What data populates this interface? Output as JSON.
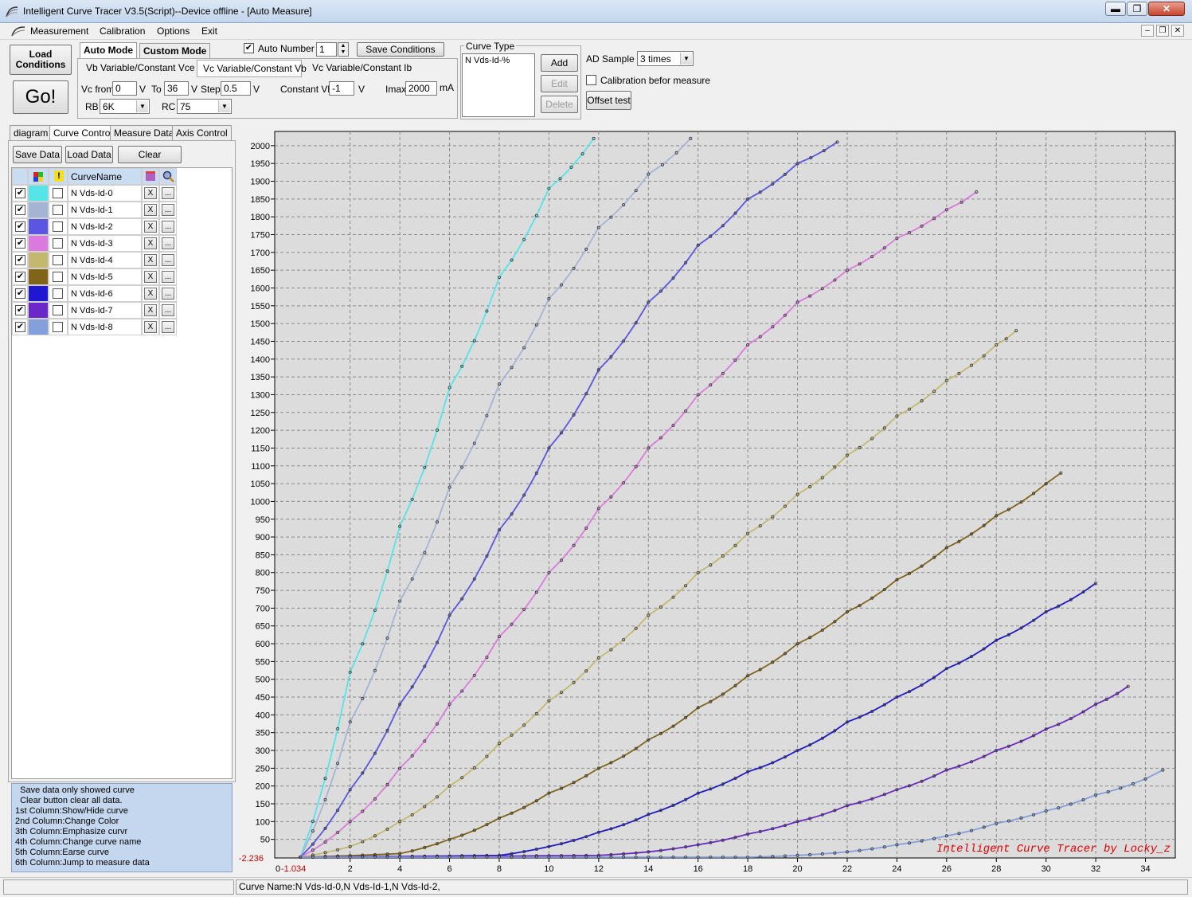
{
  "window": {
    "title": "Intelligent Curve Tracer V3.5(Script)--Device offline - [Auto Measure]",
    "min_glyph": "▬",
    "max_glyph": "❐",
    "close_glyph": "✕"
  },
  "menu": {
    "items": [
      "Measurement",
      "Calibration",
      "Options",
      "Exit"
    ],
    "mdi_min": "–",
    "mdi_restore": "❐",
    "mdi_close": "✕"
  },
  "toolbar": {
    "load_conditions": "Load Conditions",
    "go": "Go!",
    "mode_tabs": [
      "Auto Mode",
      "Custom Mode"
    ],
    "sub_tabs": [
      "Vb Variable/Constant Vce",
      "Vc Variable/Constant Vb",
      "Vc Variable/Constant Ib"
    ],
    "auto_number_label": "Auto Number",
    "auto_number_checked": "✔",
    "auto_number_value": "1",
    "save_conditions": "Save Conditions",
    "vc_from_label": "Vc from",
    "vc_from_value": "0",
    "v_unit": "V",
    "to_label": "To",
    "to_value": "36",
    "step_label": "Step",
    "step_value": "0.5",
    "constant_vb_label": "Constant Vb",
    "constant_vb_value": "-1",
    "imax_label": "Imax",
    "imax_value": "2000",
    "ma_unit": "mA",
    "rb_label": "RB",
    "rb_value": "6K",
    "rc_label": "RC",
    "rc_value": "75"
  },
  "curve_type": {
    "group_label": "Curve Type",
    "list_item": "N Vds-Id-%",
    "add": "Add",
    "edit": "Edit",
    "delete": "Delete"
  },
  "ad": {
    "label": "AD Sample",
    "value": "3 times",
    "calibration_label": "Calibration befor measure",
    "offset_test": "Offset test"
  },
  "left_tabs": [
    "diagram",
    "Curve Control",
    "Measure Data",
    "Axis Control"
  ],
  "left_buttons": {
    "save_data": "Save Data",
    "load_data": "Load Data",
    "clear": "Clear"
  },
  "curve_table": {
    "header_name": "CurveName",
    "check_glyph": "✔",
    "erase_glyph": "X",
    "jump_glyph": "...",
    "warn_glyph": "!",
    "rows": [
      {
        "name": "N Vds-Id-0",
        "color": "#55e5e8"
      },
      {
        "name": "N Vds-Id-1",
        "color": "#a4b4d4"
      },
      {
        "name": "N Vds-Id-2",
        "color": "#5a56e0"
      },
      {
        "name": "N Vds-Id-3",
        "color": "#da7ade"
      },
      {
        "name": "N Vds-Id-4",
        "color": "#c4b870"
      },
      {
        "name": "N Vds-Id-5",
        "color": "#806418"
      },
      {
        "name": "N Vds-Id-6",
        "color": "#2018d0"
      },
      {
        "name": "N Vds-Id-7",
        "color": "#6a28c8"
      },
      {
        "name": "N Vds-Id-8",
        "color": "#84a0dc"
      }
    ]
  },
  "help_lines": [
    "  Save data only showed curve",
    "  Clear button clear all data.",
    "1st Column:Show/Hide curve",
    "2nd Column:Change Color",
    "3th Column:Emphasize curvr",
    "4th Column:Change curve name",
    "5th Column:Earse curve",
    "6th Column:Jump to measure data"
  ],
  "status": {
    "curve_names": "Curve Name:N Vds-Id-0,N Vds-Id-1,N Vds-Id-2,"
  },
  "chart_data": {
    "type": "scatter",
    "title": "",
    "watermark": "Intelligent Curve Tracer by Locky_z",
    "xlim": [
      -1.034,
      35.2
    ],
    "ylim": [
      -2.236,
      2040
    ],
    "x_ticks": [
      2,
      4,
      6,
      8,
      10,
      12,
      14,
      16,
      18,
      20,
      22,
      24,
      26,
      28,
      30,
      32,
      34
    ],
    "y_ticks": [
      50,
      100,
      150,
      200,
      250,
      300,
      350,
      400,
      450,
      500,
      550,
      600,
      650,
      700,
      750,
      800,
      850,
      900,
      950,
      1000,
      1050,
      1100,
      1150,
      1200,
      1250,
      1300,
      1350,
      1400,
      1450,
      1500,
      1550,
      1600,
      1650,
      1700,
      1750,
      1800,
      1850,
      1900,
      1950,
      2000
    ],
    "x_min_label": "-1.034",
    "y_min_label": "-2.236",
    "origin_label": "0",
    "grid": true,
    "background": "#dcdcdc",
    "series": [
      {
        "name": "N Vds-Id-0",
        "color": "#55e5e8",
        "x": [
          0,
          2,
          4,
          6,
          8,
          10,
          11.8
        ],
        "y": [
          0,
          520,
          930,
          1320,
          1630,
          1880,
          2020
        ]
      },
      {
        "name": "N Vds-Id-1",
        "color": "#a4b4d4",
        "x": [
          0,
          2,
          4,
          6,
          8,
          10,
          12,
          14,
          15.7
        ],
        "y": [
          0,
          380,
          720,
          1040,
          1330,
          1570,
          1770,
          1920,
          2020
        ]
      },
      {
        "name": "N Vds-Id-2",
        "color": "#5a56e0",
        "x": [
          0,
          2,
          4,
          6,
          8,
          10,
          12,
          14,
          16,
          18,
          20,
          21.6
        ],
        "y": [
          0,
          190,
          430,
          680,
          920,
          1150,
          1370,
          1560,
          1720,
          1850,
          1950,
          2010
        ]
      },
      {
        "name": "N Vds-Id-3",
        "color": "#da7ade",
        "x": [
          0,
          2,
          4,
          6,
          8,
          10,
          12,
          14,
          16,
          18,
          20,
          22,
          24,
          26,
          27.2
        ],
        "y": [
          0,
          100,
          250,
          430,
          620,
          800,
          980,
          1150,
          1300,
          1440,
          1560,
          1650,
          1740,
          1820,
          1870
        ]
      },
      {
        "name": "N Vds-Id-4",
        "color": "#c4b870",
        "x": [
          0,
          2,
          4,
          6,
          8,
          10,
          12,
          14,
          16,
          18,
          20,
          22,
          24,
          26,
          28,
          28.8
        ],
        "y": [
          0,
          30,
          100,
          200,
          320,
          440,
          560,
          680,
          800,
          910,
          1020,
          1130,
          1240,
          1340,
          1440,
          1480
        ]
      },
      {
        "name": "N Vds-Id-5",
        "color": "#806418",
        "x": [
          0,
          4,
          6,
          8,
          10,
          12,
          14,
          16,
          18,
          20,
          22,
          24,
          26,
          28,
          30,
          30.6
        ],
        "y": [
          0,
          10,
          50,
          110,
          180,
          250,
          330,
          420,
          510,
          600,
          690,
          780,
          870,
          960,
          1050,
          1080
        ]
      },
      {
        "name": "N Vds-Id-6",
        "color": "#2018d0",
        "x": [
          0,
          8,
          10,
          12,
          14,
          16,
          18,
          20,
          22,
          24,
          26,
          28,
          30,
          32
        ],
        "y": [
          0,
          5,
          30,
          70,
          120,
          180,
          240,
          300,
          380,
          450,
          530,
          610,
          690,
          770
        ]
      },
      {
        "name": "N Vds-Id-7",
        "color": "#6a28c8",
        "x": [
          0,
          12,
          14,
          16,
          18,
          20,
          22,
          24,
          26,
          28,
          30,
          32,
          33.3
        ],
        "y": [
          0,
          5,
          15,
          35,
          65,
          100,
          145,
          190,
          245,
          300,
          360,
          430,
          480
        ]
      },
      {
        "name": "N Vds-Id-8",
        "color": "#84a0dc",
        "x": [
          0,
          18,
          20,
          22,
          24,
          26,
          28,
          30,
          32,
          34,
          34.7
        ],
        "y": [
          0,
          0,
          5,
          15,
          35,
          60,
          95,
          130,
          175,
          220,
          245
        ]
      }
    ]
  }
}
